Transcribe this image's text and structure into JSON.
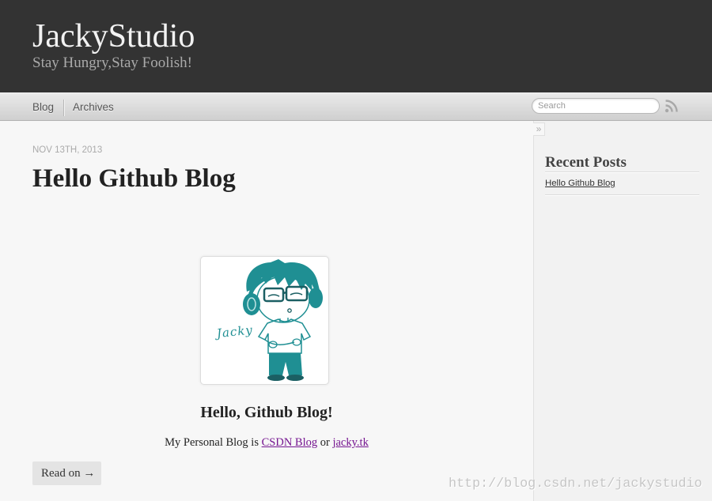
{
  "site": {
    "title": "JackyStudio",
    "subtitle": "Stay Hungry,Stay Foolish!"
  },
  "nav": {
    "items": [
      {
        "label": "Blog"
      },
      {
        "label": "Archives"
      }
    ],
    "search_placeholder": "Search",
    "feed_icon": "rss-icon"
  },
  "post": {
    "date": "NOV 13TH, 2013",
    "title": "Hello Github Blog",
    "heading": "Hello, Github Blog!",
    "body": {
      "prefix": "My Personal Blog is ",
      "link_1": "CSDN Blog",
      "between": " or ",
      "link_2": "jacky.tk"
    },
    "read_more": "Read on →"
  },
  "avatar": {
    "lettering": "Jacky"
  },
  "sidebar": {
    "toggle_label": "»",
    "recent_posts_title": "Recent Posts",
    "recent_posts": [
      {
        "title": "Hello Github Blog"
      }
    ]
  },
  "watermark": "http://blog.csdn.net/jackystudio",
  "colors": {
    "header_bg": "#333333",
    "link_visited": "#751590",
    "avatar_teal": "#1f8f93"
  }
}
